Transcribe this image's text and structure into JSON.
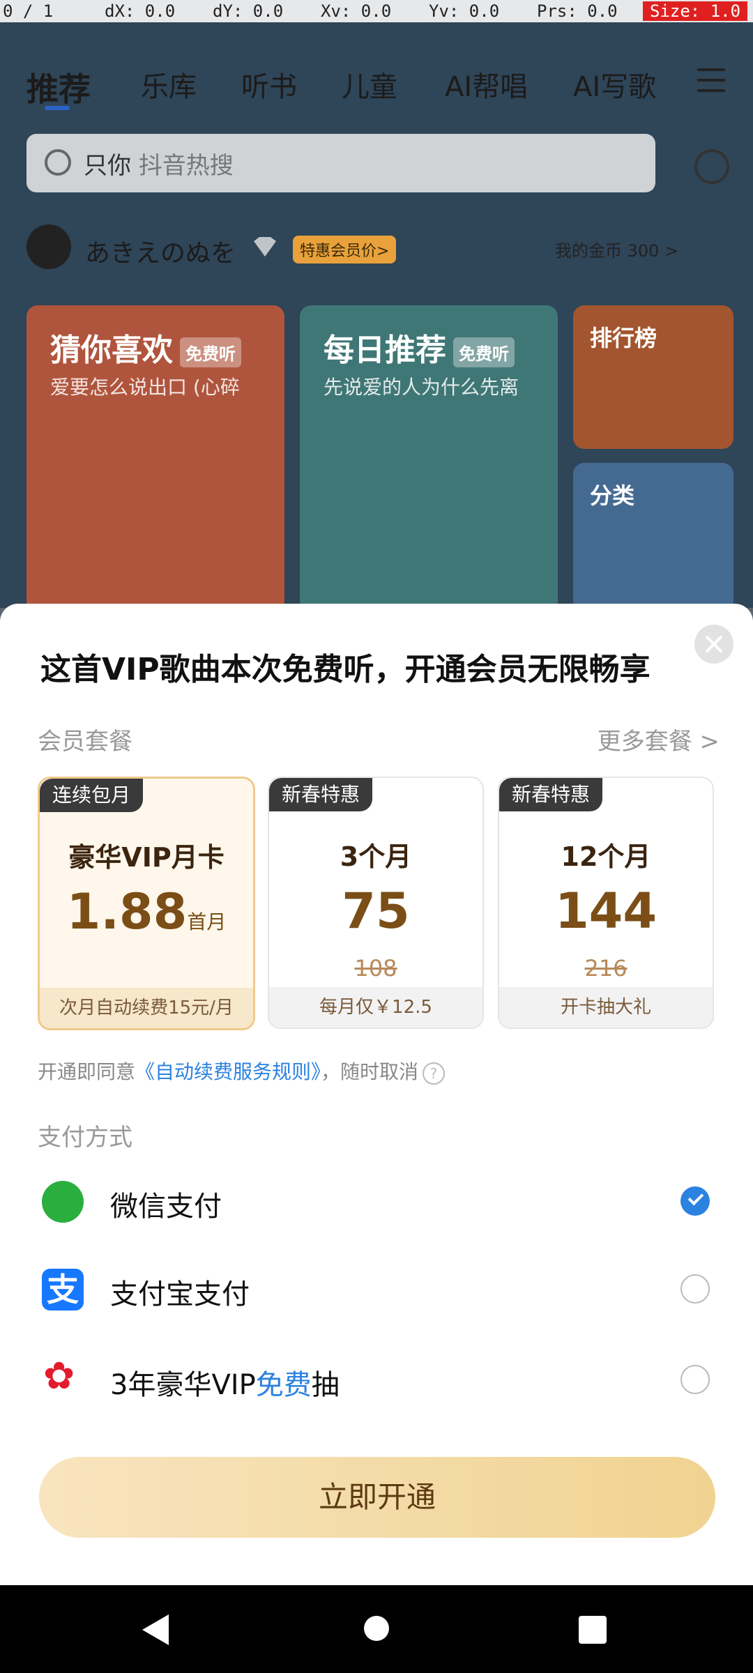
{
  "debug": {
    "pointer": "0 / 1",
    "dx": "dX: 0.0",
    "dy": "dY: 0.0",
    "xv": "Xv: 0.0",
    "yv": "Yv: 0.0",
    "prs": "Prs: 0.0",
    "size": "Size: 1.0"
  },
  "tabs": [
    "推荐",
    "乐库",
    "听书",
    "儿童",
    "AI帮唱",
    "AI写歌"
  ],
  "search": {
    "prefix": "只你",
    "hint": "抖音热搜"
  },
  "user": {
    "name": "あきえのぬを",
    "vip_tag": "特惠会员价>",
    "coins": "我的金币 300 >"
  },
  "cards": [
    {
      "title": "猜你喜欢",
      "badge": "免费听",
      "subtitle": "爱要怎么说出口 (心碎",
      "color": "#c05b3e"
    },
    {
      "title": "每日推荐",
      "badge": "免费听",
      "subtitle": "先说爱的人为什么先离",
      "color": "#3f7b7a"
    },
    {
      "title": "排行榜",
      "badge": "",
      "subtitle": "",
      "color": "#b05a2e"
    },
    {
      "title": "分类",
      "badge": "",
      "subtitle": "",
      "color": "#4a6f9a"
    }
  ],
  "sheet": {
    "title": "这首VIP歌曲本次免费听，开通会员无限畅享",
    "packages_header": "会员套餐",
    "more_packages": "更多套餐 >",
    "packages": [
      {
        "tag": "连续包月",
        "name": "豪华VIP月卡",
        "price": "1.88",
        "unit": "首月",
        "original": "",
        "footer": "次月自动续费15元/月",
        "selected": true
      },
      {
        "tag": "新春特惠",
        "name": "3个月",
        "price": "75",
        "unit": "",
        "original": "108",
        "footer": "每月仅￥12.5",
        "selected": false
      },
      {
        "tag": "新春特惠",
        "name": "12个月",
        "price": "144",
        "unit": "",
        "original": "216",
        "footer": "开卡抽大礼",
        "selected": false
      }
    ],
    "agreement": {
      "pre": "开通即同意",
      "link": "《自动续费服务规则》",
      "post": "，随时取消"
    },
    "payment_header": "支付方式",
    "payments": [
      {
        "label": "微信支付",
        "selected": true
      },
      {
        "label": "支付宝支付",
        "selected": false
      }
    ],
    "promo": {
      "pre": "3年豪华VIP",
      "highlight": "免费",
      "post": "抽"
    },
    "cta": "立即开通"
  }
}
